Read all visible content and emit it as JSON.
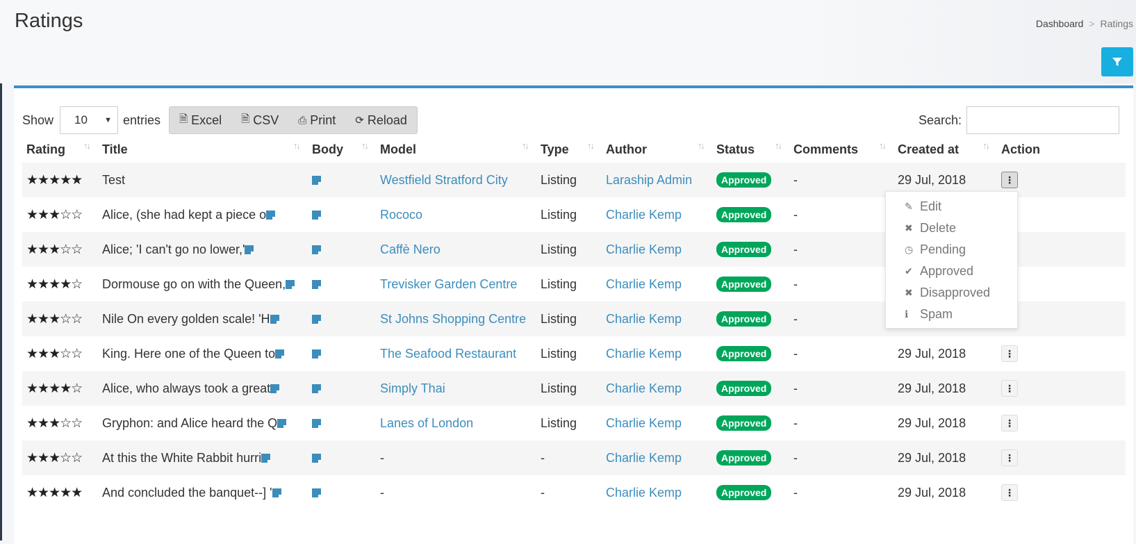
{
  "page": {
    "title": "Ratings"
  },
  "breadcrumb": {
    "dashboard": "Dashboard",
    "sep": ">",
    "current": "Ratings"
  },
  "icons": {
    "filter": "filter-icon",
    "excel": "file-excel-icon",
    "csv": "file-csv-icon",
    "print": "print-icon",
    "reload": "refresh-icon",
    "body": "note-icon",
    "action": "vertical-ellipsis-icon"
  },
  "colors": {
    "accent": "#3c8dbc",
    "filter": "#17aee0",
    "approved": "#00a65a",
    "box_border": "#3a8fc7"
  },
  "toolbar": {
    "show": "Show",
    "entries_value": "10",
    "entries": "entries",
    "excel": "Excel",
    "csv": "CSV",
    "print": "Print",
    "reload": "Reload",
    "search_label": "Search:",
    "search_value": ""
  },
  "table": {
    "headers": [
      "Rating",
      "Title",
      "Body",
      "Model",
      "Type",
      "Author",
      "Status",
      "Comments",
      "Created at",
      "Action"
    ],
    "rows": [
      {
        "rating": "★★★★★",
        "title": "Test",
        "model": "Westfield Stratford City",
        "type": "Listing",
        "author": "Laraship Admin",
        "status": "Approved",
        "comments": "-",
        "created": "29 Jul, 2018"
      },
      {
        "rating": "★★★☆☆",
        "title": "Alice, (she had kept a piece o",
        "model": "Rococo",
        "type": "Listing",
        "author": "Charlie Kemp",
        "status": "Approved",
        "comments": "-",
        "created": ""
      },
      {
        "rating": "★★★☆☆",
        "title": "Alice; 'I can't go no lower,'",
        "model": "Caffè Nero",
        "type": "Listing",
        "author": "Charlie Kemp",
        "status": "Approved",
        "comments": "-",
        "created": ""
      },
      {
        "rating": "★★★★☆",
        "title": "Dormouse go on with the Queen,",
        "model": "Trevisker Garden Centre",
        "type": "Listing",
        "author": "Charlie Kemp",
        "status": "Approved",
        "comments": "-",
        "created": ""
      },
      {
        "rating": "★★★☆☆",
        "title": "Nile On every golden scale! 'H",
        "model": "St Johns Shopping Centre",
        "type": "Listing",
        "author": "Charlie Kemp",
        "status": "Approved",
        "comments": "-",
        "created": ""
      },
      {
        "rating": "★★★☆☆",
        "title": "King. Here one of the Queen to",
        "model": "The Seafood Restaurant",
        "type": "Listing",
        "author": "Charlie Kemp",
        "status": "Approved",
        "comments": "-",
        "created": "29 Jul, 2018"
      },
      {
        "rating": "★★★★☆",
        "title": "Alice, who always took a great",
        "model": "Simply Thai",
        "type": "Listing",
        "author": "Charlie Kemp",
        "status": "Approved",
        "comments": "-",
        "created": "29 Jul, 2018"
      },
      {
        "rating": "★★★☆☆",
        "title": "Gryphon: and Alice heard the Q",
        "model": "Lanes of London",
        "type": "Listing",
        "author": "Charlie Kemp",
        "status": "Approved",
        "comments": "-",
        "created": "29 Jul, 2018"
      },
      {
        "rating": "★★★☆☆",
        "title": "At this the White Rabbit hurri",
        "model": "-",
        "type": "-",
        "author": "Charlie Kemp",
        "status": "Approved",
        "comments": "-",
        "created": "29 Jul, 2018"
      },
      {
        "rating": "★★★★★",
        "title": "And concluded the banquet--] '",
        "model": "-",
        "type": "-",
        "author": "Charlie Kemp",
        "status": "Approved",
        "comments": "-",
        "created": "29 Jul, 2018"
      }
    ]
  },
  "action_menu": {
    "items": [
      {
        "label": "Edit",
        "icon": "pencil-icon"
      },
      {
        "label": "Delete",
        "icon": "times-icon"
      },
      {
        "label": "Pending",
        "icon": "clock-icon"
      },
      {
        "label": "Approved",
        "icon": "check-icon"
      },
      {
        "label": "Disapproved",
        "icon": "times-icon"
      },
      {
        "label": "Spam",
        "icon": "info-icon"
      }
    ]
  }
}
